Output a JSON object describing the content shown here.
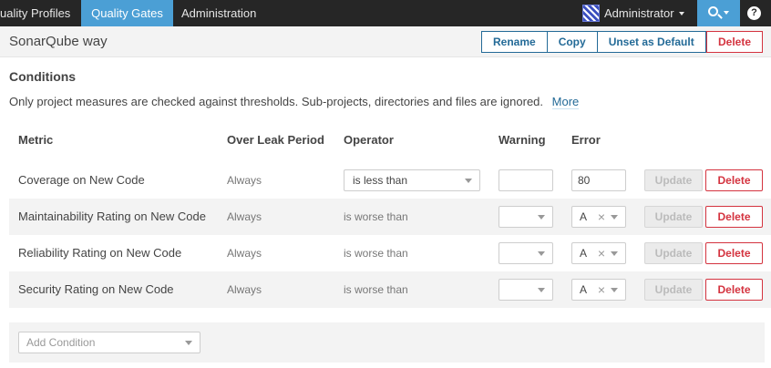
{
  "nav": {
    "items": [
      {
        "label": "uality Profiles"
      },
      {
        "label": "Quality Gates"
      },
      {
        "label": "Administration"
      }
    ],
    "user": "Administrator",
    "help": "?"
  },
  "header": {
    "title": "SonarQube way",
    "rename": "Rename",
    "copy": "Copy",
    "unset_default": "Unset as Default",
    "delete": "Delete"
  },
  "conditions": {
    "title": "Conditions",
    "description": "Only project measures are checked against thresholds. Sub-projects, directories and files are ignored.",
    "more": "More",
    "columns": {
      "metric": "Metric",
      "leak": "Over Leak Period",
      "operator": "Operator",
      "warning": "Warning",
      "error": "Error"
    },
    "rows": [
      {
        "metric": "Coverage on New Code",
        "leak": "Always",
        "operator": "is less than",
        "warning": "",
        "error": "80",
        "update": "Update",
        "delete": "Delete"
      },
      {
        "metric": "Maintainability Rating on New Code",
        "leak": "Always",
        "operator": "is worse than",
        "warning": "",
        "error": "A",
        "update": "Update",
        "delete": "Delete"
      },
      {
        "metric": "Reliability Rating on New Code",
        "leak": "Always",
        "operator": "is worse than",
        "warning": "",
        "error": "A",
        "update": "Update",
        "delete": "Delete"
      },
      {
        "metric": "Security Rating on New Code",
        "leak": "Always",
        "operator": "is worse than",
        "warning": "",
        "error": "A",
        "update": "Update",
        "delete": "Delete"
      }
    ],
    "add_placeholder": "Add Condition"
  },
  "colors": {
    "nav_bg": "#262626",
    "accent": "#4b9fd5",
    "link": "#236a97",
    "danger": "#d4333f"
  }
}
